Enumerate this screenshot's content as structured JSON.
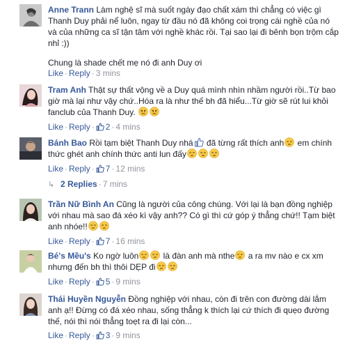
{
  "comments": [
    {
      "author": "Anne Trann",
      "text": "Làm nghệ sĩ mà suốt ngày đạo chất xám thì chẳng có việc gì Thanh Duy phải nể luôn, ngay từ đầu nó đã không coi trọng cái nghề của nó và của những ca sĩ tận tâm với nghề khác rồi. Tại sao lại đi bênh bọn trộm cắp nhỉ :))",
      "text2": "Chung là shade chết mẹ nó đi anh Duy ơi",
      "like": "Like",
      "reply": "Reply",
      "time": "3 mins"
    },
    {
      "author": "Tram Anh",
      "text": "Thật sự thất vộng về a Duy quá mình nhìn nhầm người rồi..Từ bao giờ mà lại như vậy chứ..Hóa ra là như thế bh đã hiểu...Từ giờ sẽ rút lui khỏi fanclub của Thanh Duy.",
      "like": "Like",
      "reply": "Reply",
      "likes_count": "2",
      "time": "4 mins"
    },
    {
      "author": "Bánh Bao",
      "text_a": "Rồi tạm biệt Thanh Duy nhá",
      "text_b": " đã từng rất thích anh",
      "text_c": " em chính thức ghét anh chính thức anti lun đấy",
      "like": "Like",
      "reply": "Reply",
      "likes_count": "7",
      "time": "12 mins"
    },
    {
      "author": "Trần Nữ Bình An",
      "text": "Cũng là người của công chúng. Với lại là bạn đồng nghiệp với nhau mà sao đá xéo kì vậy anh?? Có gì thì cứ góp ý thẳng chứ!! Tạm biệt anh nhóe!!",
      "like": "Like",
      "reply": "Reply",
      "likes_count": "7",
      "time": "16 mins"
    },
    {
      "author": "Bé's Mều's",
      "text_a": "Ko ngờ luôn",
      "text_b": " là đàn anh mà nthe",
      "text_c": " a ra mv nào e cx xm nhưng đến bh thì thôi DẸP đi",
      "like": "Like",
      "reply": "Reply",
      "likes_count": "5",
      "time": "9 mins"
    },
    {
      "author": "Thái Huyền Nguyễn",
      "text": "Đồng nghiệp với nhau, còn đi trên con đường dài lắm anh ạ!! Đừng có đá xéo nhau, sống thẳng k thích lại cứ thích đi quẹo đường thế, nói thì nói thẳng toẹt ra đi lại còn...",
      "like": "Like",
      "reply": "Reply",
      "likes_count": "3",
      "time": "9 mins"
    }
  ],
  "replies_link": "2 Replies",
  "replies_time": "7 mins",
  "dot": "·",
  "colors": {
    "link": "#365899",
    "meta": "#90949c",
    "text": "#1d2129",
    "emoji": "#f7c948"
  },
  "icons": [
    "thumbs-up-icon",
    "angry-face-icon",
    "unamused-face-icon",
    "reply-arrow-icon"
  ]
}
